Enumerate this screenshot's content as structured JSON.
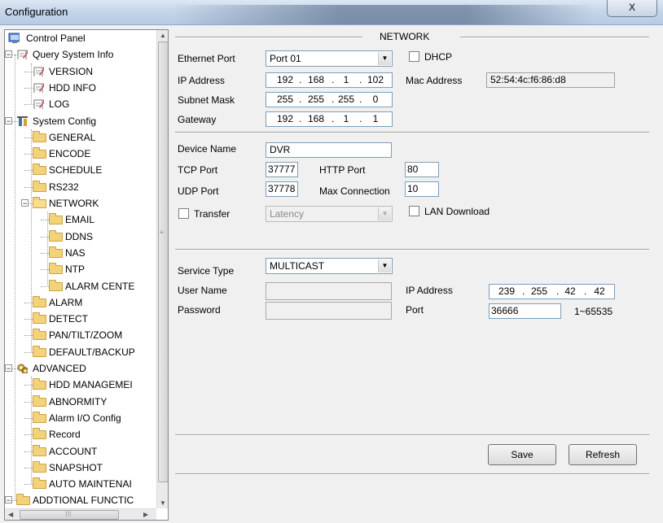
{
  "window": {
    "title": "Configuration",
    "close_glyph": "X"
  },
  "tree": {
    "items": [
      {
        "label": "Control Panel",
        "icon": "monitor-icon"
      },
      {
        "label": "Query System Info",
        "icon": "document-icon"
      },
      {
        "label": "VERSION",
        "icon": "document-icon"
      },
      {
        "label": "HDD INFO",
        "icon": "document-icon"
      },
      {
        "label": "LOG",
        "icon": "document-icon"
      },
      {
        "label": "System Config",
        "icon": "settings-icon"
      },
      {
        "label": "GENERAL",
        "icon": "folder-icon"
      },
      {
        "label": "ENCODE",
        "icon": "folder-icon"
      },
      {
        "label": "SCHEDULE",
        "icon": "folder-icon"
      },
      {
        "label": "RS232",
        "icon": "folder-icon"
      },
      {
        "label": "NETWORK",
        "icon": "folder-open-icon"
      },
      {
        "label": "EMAIL",
        "icon": "folder-icon"
      },
      {
        "label": "DDNS",
        "icon": "folder-icon"
      },
      {
        "label": "NAS",
        "icon": "folder-icon"
      },
      {
        "label": "NTP",
        "icon": "folder-icon"
      },
      {
        "label": "ALARM CENTE",
        "icon": "folder-icon"
      },
      {
        "label": "ALARM",
        "icon": "folder-icon"
      },
      {
        "label": "DETECT",
        "icon": "folder-icon"
      },
      {
        "label": "PAN/TILT/ZOOM",
        "icon": "folder-icon"
      },
      {
        "label": "DEFAULT/BACKUP",
        "icon": "folder-icon"
      },
      {
        "label": "ADVANCED",
        "icon": "gears-icon"
      },
      {
        "label": "HDD MANAGEMEI",
        "icon": "folder-icon"
      },
      {
        "label": "ABNORMITY",
        "icon": "folder-icon"
      },
      {
        "label": "Alarm I/O Config",
        "icon": "folder-icon"
      },
      {
        "label": "Record",
        "icon": "folder-icon"
      },
      {
        "label": "ACCOUNT",
        "icon": "folder-icon"
      },
      {
        "label": "SNAPSHOT",
        "icon": "folder-icon"
      },
      {
        "label": "AUTO MAINTENAI",
        "icon": "folder-icon"
      },
      {
        "label": "ADDTIONAL FUNCTIC",
        "icon": "folder-icon"
      }
    ]
  },
  "network": {
    "section_title": "NETWORK",
    "ethernet_port_label": "Ethernet Port",
    "ethernet_port_value": "Port 01",
    "dhcp_label": "DHCP",
    "ip_address_label": "IP Address",
    "ip": [
      "192",
      "168",
      "1",
      "102"
    ],
    "mac_address_label": "Mac Address",
    "mac_address_value": "52:54:4c:f6:86:d8",
    "subnet_mask_label": "Subnet Mask",
    "subnet": [
      "255",
      "255",
      "255",
      "0"
    ],
    "gateway_label": "Gateway",
    "gateway": [
      "192",
      "168",
      "1",
      "1"
    ],
    "device_name_label": "Device Name",
    "device_name_value": "DVR",
    "tcp_port_label": "TCP Port",
    "tcp_port_value": "37777",
    "http_port_label": "HTTP Port",
    "http_port_value": "80",
    "udp_port_label": "UDP Port",
    "udp_port_value": "37778",
    "max_connection_label": "Max Connection",
    "max_connection_value": "10",
    "transfer_label": "Transfer",
    "transfer_value": "Latency",
    "lan_download_label": "LAN Download",
    "service_type_label": "Service Type",
    "service_type_value": "MULTICAST",
    "user_name_label": "User Name",
    "password_label": "Password",
    "service_ip_label": "IP Address",
    "service_ip": [
      "239",
      "255",
      "42",
      "42"
    ],
    "port_label": "Port",
    "port_value": "36666",
    "port_range": "1~65535",
    "save_label": "Save",
    "refresh_label": "Refresh"
  }
}
